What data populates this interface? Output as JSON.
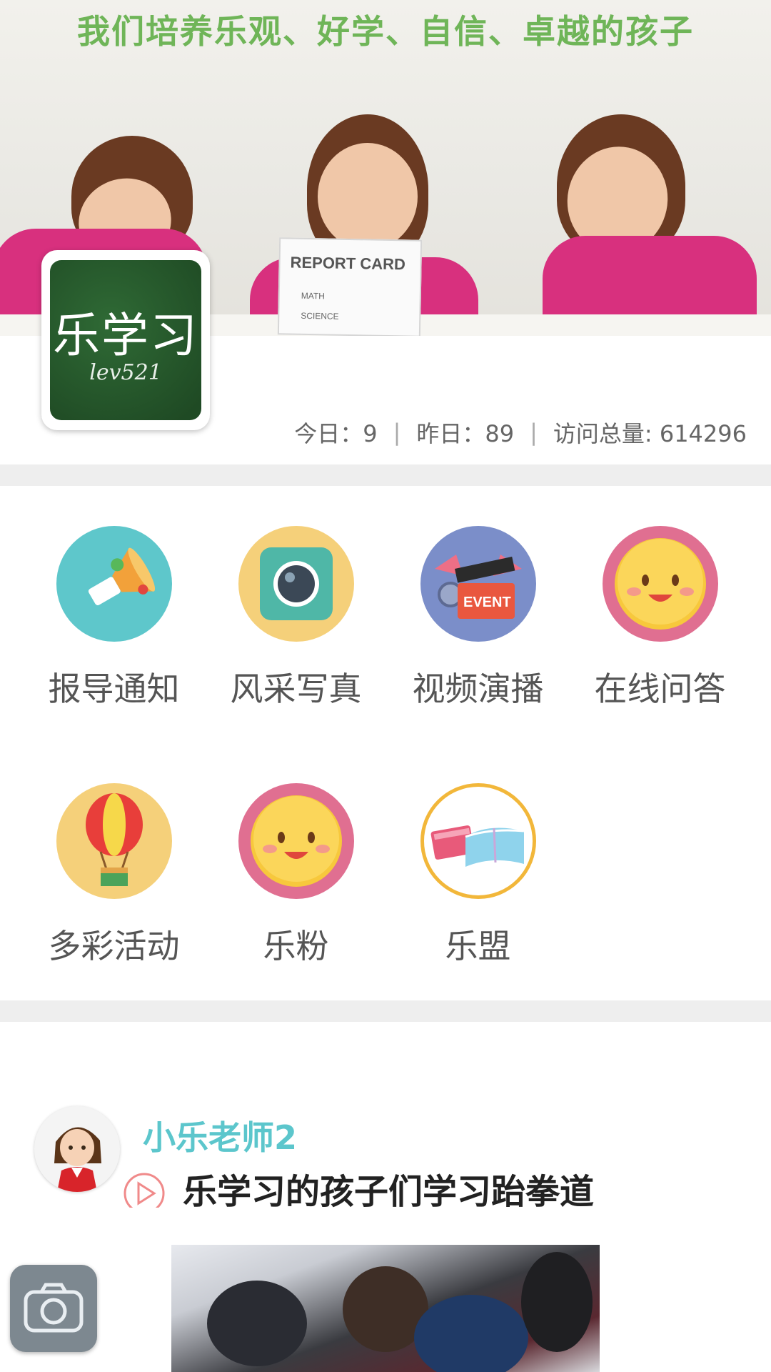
{
  "banner": {
    "slogan": "我们培养乐观、好学、自信、卓越的孩子",
    "report_card": {
      "title": "REPORT CARD",
      "line1": "MATH",
      "line2": "SCIENCE"
    }
  },
  "logo": {
    "title": "乐学习",
    "subtitle": "lev521"
  },
  "stats": {
    "today": "今日：9",
    "yesterday": "昨日：89",
    "total": "访问总量: 614296",
    "separator": "|"
  },
  "menu": {
    "items": [
      {
        "label": "报导通知",
        "icon": "megaphone-icon"
      },
      {
        "label": "风采写真",
        "icon": "camera-icon"
      },
      {
        "label": "视频演播",
        "icon": "video-clapper-icon"
      },
      {
        "label": "在线问答",
        "icon": "smiley-icon"
      },
      {
        "label": "多彩活动",
        "icon": "hot-air-balloon-icon"
      },
      {
        "label": "乐粉",
        "icon": "smiley-icon"
      },
      {
        "label": "乐盟",
        "icon": "books-icon"
      }
    ]
  },
  "post": {
    "author": "小乐老师2",
    "title": "乐学习的孩子们学习跆拳道"
  },
  "colors": {
    "slogan_green": "#6fb558",
    "author_teal": "#5cc6cc",
    "divider": "#eeeeee"
  }
}
